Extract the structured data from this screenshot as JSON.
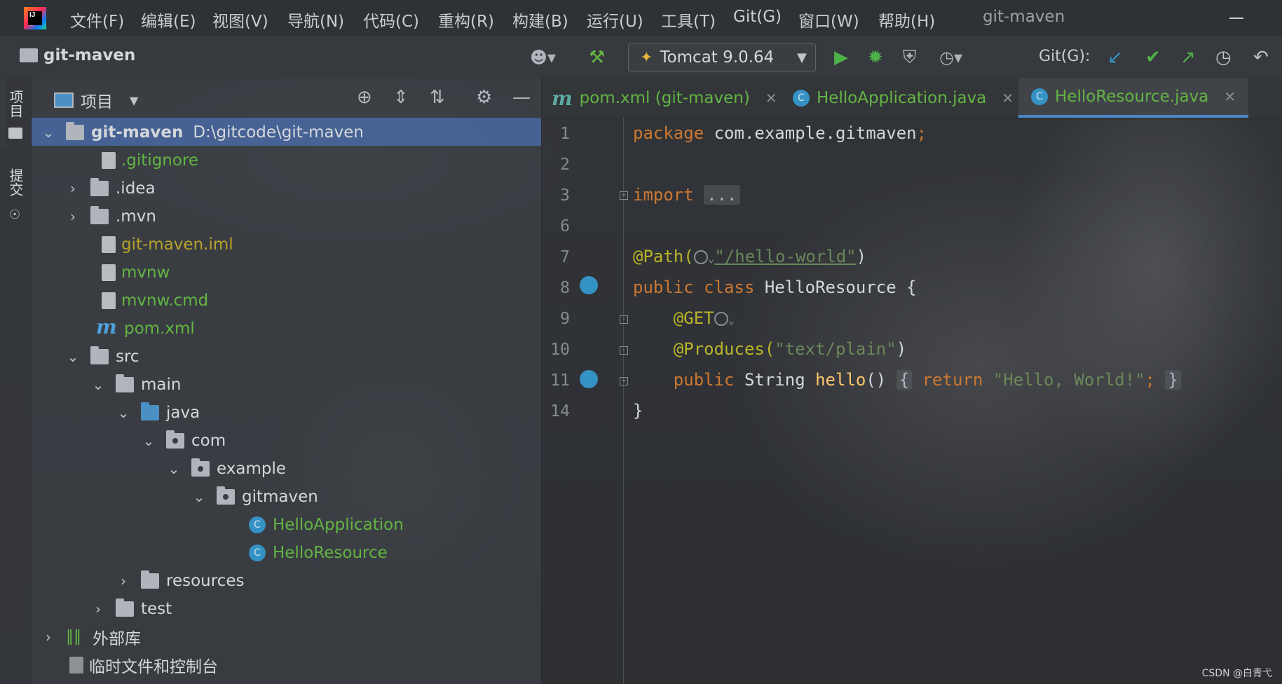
{
  "menubar": {
    "items": [
      "文件(F)",
      "编辑(E)",
      "视图(V)",
      "导航(N)",
      "代码(C)",
      "重构(R)",
      "构建(B)",
      "运行(U)",
      "工具(T)",
      "Git(G)",
      "窗口(W)",
      "帮助(H)"
    ],
    "window_title": "git-maven"
  },
  "toolbar": {
    "project_name": "git-maven",
    "run_config": "Tomcat 9.0.64",
    "git_label": "Git(G):"
  },
  "side_strip": {
    "project_label": "项目",
    "commit_label": "提交"
  },
  "project_panel": {
    "title": "项目",
    "tree": [
      {
        "label": "git-maven",
        "path": "D:\\gitcode\\git-maven",
        "icon": "module-folder-icon",
        "expanded": true,
        "selected": true
      },
      {
        "label": ".gitignore",
        "icon": "gitignore-file-icon"
      },
      {
        "label": ".idea",
        "icon": "folder-icon",
        "expanded": false
      },
      {
        "label": ".mvn",
        "icon": "folder-icon",
        "expanded": false
      },
      {
        "label": "git-maven.iml",
        "icon": "iml-file-icon"
      },
      {
        "label": "mvnw",
        "icon": "shell-file-icon"
      },
      {
        "label": "mvnw.cmd",
        "icon": "text-file-icon"
      },
      {
        "label": "pom.xml",
        "icon": "maven-icon"
      },
      {
        "label": "src",
        "icon": "folder-icon",
        "expanded": true
      },
      {
        "label": "main",
        "icon": "folder-icon",
        "expanded": true
      },
      {
        "label": "java",
        "icon": "source-folder-icon",
        "expanded": true
      },
      {
        "label": "com",
        "icon": "package-icon",
        "expanded": true
      },
      {
        "label": "example",
        "icon": "package-icon",
        "expanded": true
      },
      {
        "label": "gitmaven",
        "icon": "package-icon",
        "expanded": true
      },
      {
        "label": "HelloApplication",
        "icon": "class-icon"
      },
      {
        "label": "HelloResource",
        "icon": "class-icon"
      },
      {
        "label": "resources",
        "icon": "resources-folder-icon",
        "expanded": false
      },
      {
        "label": "test",
        "icon": "folder-icon",
        "expanded": false
      },
      {
        "label": "外部库",
        "icon": "library-icon",
        "expanded": false
      },
      {
        "label": "临时文件和控制台",
        "icon": "scratch-icon"
      }
    ]
  },
  "editor": {
    "tabs": [
      {
        "label": "pom.xml (git-maven)",
        "icon": "maven-icon"
      },
      {
        "label": "HelloApplication.java",
        "icon": "class-icon"
      },
      {
        "label": "HelloResource.java",
        "icon": "class-icon",
        "active": true
      }
    ],
    "line_numbers": [
      "1",
      "2",
      "3",
      "6",
      "7",
      "8",
      "9",
      "10",
      "11",
      "14"
    ],
    "code": {
      "l1_kw": "package",
      "l1_rest": " com.example.gitmaven",
      "l1_semi": ";",
      "l3_kw": "import",
      "l3_fold": "...",
      "l7_ann": "@Path(",
      "l7_str": "\"/hello-world\"",
      "l7_close": ")",
      "l8_kw": "public class",
      "l8_rest": " HelloResource {",
      "l9_ann": "@GET",
      "l10_ann": "@Produces(",
      "l10_str": "\"text/plain\"",
      "l10_close": ")",
      "l11_kw": "public",
      "l11_type": " String ",
      "l11_fn": "hello",
      "l11_paren": "() ",
      "l11_brace_open": "{",
      "l11_ret": " return ",
      "l11_str": "\"Hello, World!\"",
      "l11_semi": "; ",
      "l11_brace_close": "}",
      "l14": "}"
    }
  },
  "watermark": "CSDN @白青弋",
  "colors": {
    "keyword": "#cc7832",
    "annotation": "#bbb529",
    "string": "#6a8759",
    "selection": "#4b6eaf",
    "tab_underline": "#4a88c7"
  }
}
